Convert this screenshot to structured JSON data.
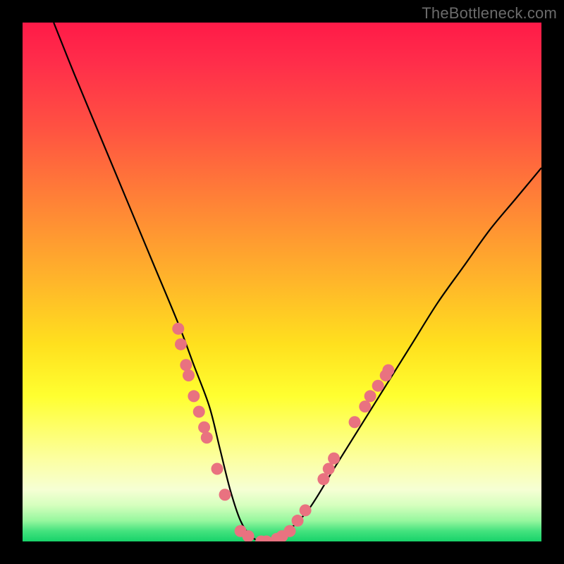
{
  "watermark": "TheBottleneck.com",
  "colors": {
    "background": "#000000",
    "gradient_top": "#ff1a48",
    "gradient_mid": "#ffe01e",
    "gradient_bottom": "#17d36a",
    "curve": "#000000",
    "marker": "#e97280"
  },
  "chart_data": {
    "type": "line",
    "title": "",
    "xlabel": "",
    "ylabel": "",
    "x_range": [
      0,
      100
    ],
    "y_range": [
      0,
      100
    ],
    "grid": false,
    "legend": false,
    "series": [
      {
        "name": "bottleneck-curve",
        "x": [
          6,
          10,
          15,
          20,
          25,
          30,
          33,
          36,
          38,
          40,
          42,
          44,
          46,
          48,
          50,
          55,
          60,
          65,
          70,
          75,
          80,
          85,
          90,
          95,
          100
        ],
        "y": [
          100,
          90,
          78,
          66,
          54,
          42,
          34,
          26,
          18,
          10,
          4,
          1,
          0,
          0,
          1,
          6,
          14,
          22,
          30,
          38,
          46,
          53,
          60,
          66,
          72
        ]
      }
    ],
    "markers": [
      {
        "x": 30.0,
        "y": 41
      },
      {
        "x": 30.5,
        "y": 38
      },
      {
        "x": 31.5,
        "y": 34
      },
      {
        "x": 32.0,
        "y": 32
      },
      {
        "x": 33.0,
        "y": 28
      },
      {
        "x": 34.0,
        "y": 25
      },
      {
        "x": 35.0,
        "y": 22
      },
      {
        "x": 35.5,
        "y": 20
      },
      {
        "x": 37.5,
        "y": 14
      },
      {
        "x": 39.0,
        "y": 9
      },
      {
        "x": 42.0,
        "y": 2
      },
      {
        "x": 43.5,
        "y": 1
      },
      {
        "x": 46.0,
        "y": 0
      },
      {
        "x": 47.0,
        "y": 0
      },
      {
        "x": 49.0,
        "y": 0.5
      },
      {
        "x": 50.0,
        "y": 1
      },
      {
        "x": 51.5,
        "y": 2
      },
      {
        "x": 53.0,
        "y": 4
      },
      {
        "x": 54.5,
        "y": 6
      },
      {
        "x": 58.0,
        "y": 12
      },
      {
        "x": 59.0,
        "y": 14
      },
      {
        "x": 60.0,
        "y": 16
      },
      {
        "x": 64.0,
        "y": 23
      },
      {
        "x": 66.0,
        "y": 26
      },
      {
        "x": 67.0,
        "y": 28
      },
      {
        "x": 68.5,
        "y": 30
      },
      {
        "x": 70.0,
        "y": 32
      },
      {
        "x": 70.5,
        "y": 33
      }
    ],
    "annotations": []
  }
}
